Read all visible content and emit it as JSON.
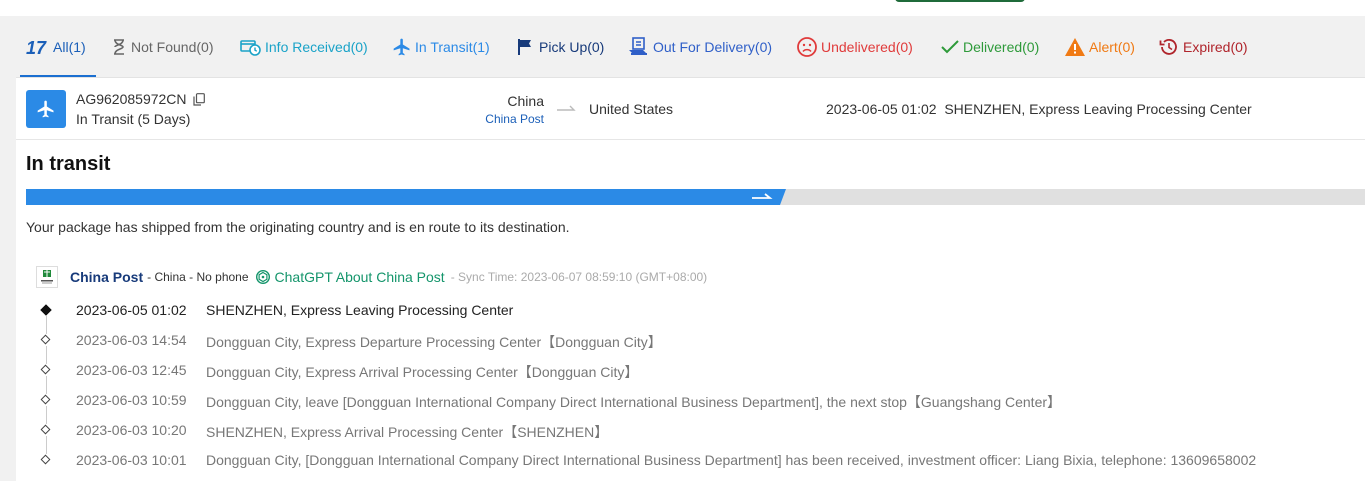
{
  "tabs": [
    {
      "name": "all",
      "label": "All",
      "count": "(1)",
      "color": "#1b5fb8",
      "icon": "17track-logo-icon",
      "active": true
    },
    {
      "name": "not-found",
      "label": "Not Found",
      "count": "(0)",
      "color": "#666666",
      "icon": "hourglass-icon"
    },
    {
      "name": "info-received",
      "label": "Info Received",
      "count": "(0)",
      "color": "#1aa3c8",
      "icon": "info-received-icon"
    },
    {
      "name": "in-transit",
      "label": "In Transit",
      "count": "(1)",
      "color": "#2b8ae6",
      "icon": "airplane-icon"
    },
    {
      "name": "pick-up",
      "label": "Pick Up",
      "count": "(0)",
      "color": "#173a7a",
      "icon": "flag-icon"
    },
    {
      "name": "out-for-delivery",
      "label": "Out For Delivery",
      "count": "(0)",
      "color": "#2f5fc8",
      "icon": "delivery-icon"
    },
    {
      "name": "undelivered",
      "label": "Undelivered",
      "count": "(0)",
      "color": "#e03b3b",
      "icon": "sad-face-icon"
    },
    {
      "name": "delivered",
      "label": "Delivered",
      "count": "(0)",
      "color": "#2e9a3a",
      "icon": "checkmark-icon"
    },
    {
      "name": "alert",
      "label": "Alert",
      "count": "(0)",
      "color": "#f07a14",
      "icon": "warning-icon"
    },
    {
      "name": "expired",
      "label": "Expired",
      "count": "(0)",
      "color": "#b0252c",
      "icon": "history-icon"
    }
  ],
  "shipment": {
    "tracking_number": "AG962085972CN",
    "status": "In Transit (5 Days)",
    "origin": "China",
    "carrier_link": "China Post",
    "destination": "United States",
    "latest_time": "2023-06-05 01:02",
    "latest_event": "SHENZHEN, Express Leaving Processing Center"
  },
  "status_title": "In transit",
  "progress": {
    "completed_stages": 2,
    "total_stages": 4,
    "color_done": "#2b8ae6",
    "color_todo": "#e0e0e0"
  },
  "description": "Your package has shipped from the originating country and is en route to its destination.",
  "carrier": {
    "name": "China Post",
    "meta": "- China - No phone",
    "chatgpt_label": "ChatGPT About China Post",
    "sync_time": "- Sync Time: 2023-06-07 08:59:10 (GMT+08:00)"
  },
  "events": [
    {
      "time": "2023-06-05 01:02",
      "text": "SHENZHEN, Express Leaving Processing Center"
    },
    {
      "time": "2023-06-03 14:54",
      "text": "Dongguan City, Express Departure Processing Center【Dongguan City】"
    },
    {
      "time": "2023-06-03 12:45",
      "text": "Dongguan City, Express Arrival Processing Center【Dongguan City】"
    },
    {
      "time": "2023-06-03 10:59",
      "text": "Dongguan City, leave [Dongguan International Company Direct International Business Department], the next stop【Guangshang Center】"
    },
    {
      "time": "2023-06-03 10:20",
      "text": "SHENZHEN, Express Arrival Processing Center【SHENZHEN】"
    },
    {
      "time": "2023-06-03 10:01",
      "text": "Dongguan City, [Dongguan International Company Direct International Business Department] has been received, investment officer: Liang Bixia, telephone: 13609658002"
    }
  ]
}
